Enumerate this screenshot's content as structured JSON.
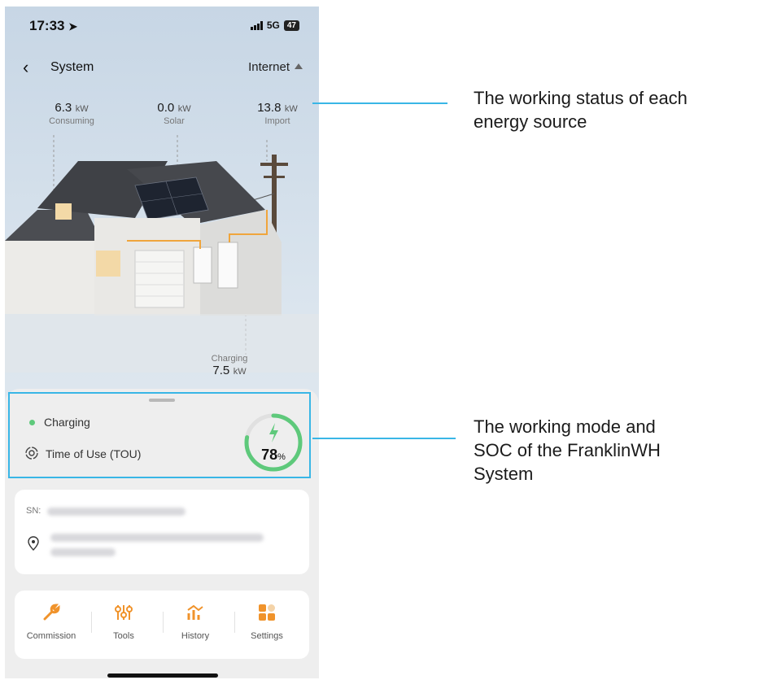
{
  "statusbar": {
    "time": "17:33",
    "network": "5G",
    "battery": "47"
  },
  "nav": {
    "title": "System",
    "right_label": "Internet"
  },
  "metrics": {
    "consuming": {
      "value": "6.3",
      "unit": "kW",
      "label": "Consuming"
    },
    "solar": {
      "value": "0.0",
      "unit": "kW",
      "label": "Solar"
    },
    "import": {
      "value": "13.8",
      "unit": "kW",
      "label": "Import"
    },
    "battery": {
      "value": "7.5",
      "unit": "kW",
      "label": "Charging"
    }
  },
  "status": {
    "state": "Charging",
    "mode": "Time of Use (TOU)",
    "soc_value": "78",
    "soc_unit": "%",
    "soc_fraction": 0.78
  },
  "info": {
    "sn_label": "SN:"
  },
  "actions": [
    "Commission",
    "Tools",
    "History",
    "Settings"
  ],
  "annotations": {
    "top": "The working status of each energy source",
    "top_lines": [
      "The working status of each",
      "energy source"
    ],
    "bottom_lines": [
      "The working mode and",
      "SOC of the FranklinWH",
      "System"
    ]
  },
  "colors": {
    "accent": "#39b6e6",
    "soc_green": "#5ec97b",
    "action_orange": "#f0932b"
  }
}
